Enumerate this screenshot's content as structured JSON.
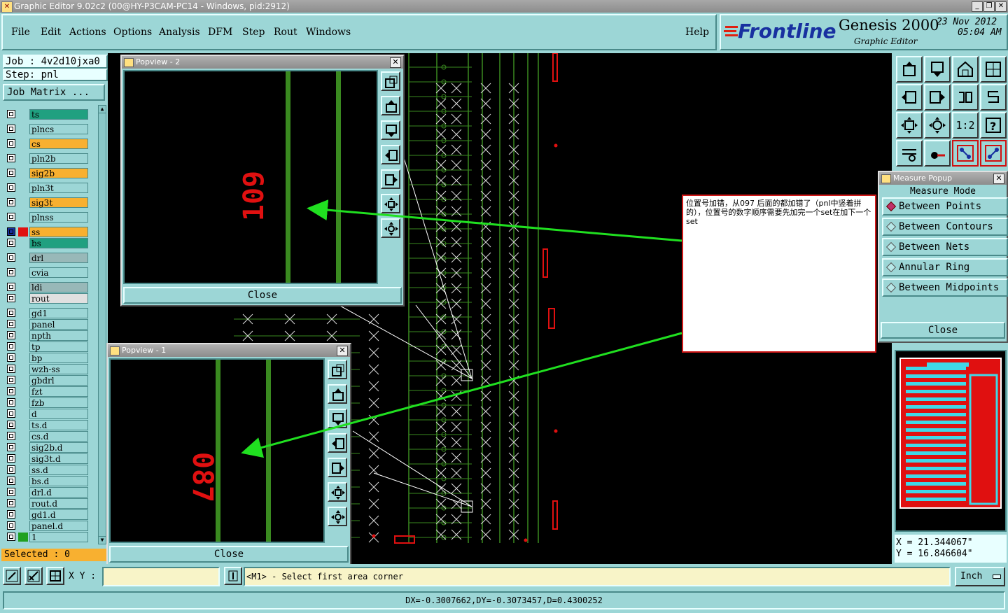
{
  "window": {
    "title": "Graphic Editor 9.02c2 (00@HY-P3CAM-PC14 - Windows, pid:2912)"
  },
  "menu": {
    "items": [
      "File",
      "Edit",
      "Actions",
      "Options",
      "Analysis",
      "DFM",
      "Step",
      "Rout",
      "Windows"
    ],
    "help": "Help"
  },
  "brand": {
    "logo": "Frontline",
    "product": "Genesis 2000",
    "subtitle": "Graphic Editor",
    "date": "23 Nov 2012",
    "time": "05:04 AM"
  },
  "job": {
    "job_label": "Job : 4v2d10jxa0",
    "step_label": "Step: pnl",
    "matrix_button": "Job Matrix ..."
  },
  "layers": [
    {
      "name": "ts",
      "color": "#20a080"
    },
    {
      "name": "plncs",
      "color": "#9cd6d6"
    },
    {
      "name": "cs",
      "color": "#f8b030"
    },
    {
      "name": "pln2b",
      "color": "#9cd6d6"
    },
    {
      "name": "sig2b",
      "color": "#f8b030"
    },
    {
      "name": "pln3t",
      "color": "#9cd6d6"
    },
    {
      "name": "sig3t",
      "color": "#f8b030"
    },
    {
      "name": "plnss",
      "color": "#9cd6d6"
    },
    {
      "name": "ss",
      "color": "#f8b030"
    },
    {
      "name": "bs",
      "color": "#20a080"
    },
    {
      "name": "drl",
      "color": "#98b8b8"
    },
    {
      "name": "cvia",
      "color": "#9cd6d6"
    },
    {
      "name": "ldi",
      "color": "#98b8b8"
    },
    {
      "name": "rout",
      "color": "#e0e0e0"
    },
    {
      "name": "gd1",
      "color": "#9cd6d6"
    },
    {
      "name": "panel",
      "color": "#9cd6d6"
    },
    {
      "name": "npth",
      "color": "#9cd6d6"
    },
    {
      "name": "tp",
      "color": "#9cd6d6"
    },
    {
      "name": "bp",
      "color": "#9cd6d6"
    },
    {
      "name": "wzh-ss",
      "color": "#9cd6d6"
    },
    {
      "name": "gbdrl",
      "color": "#9cd6d6"
    },
    {
      "name": "fzt",
      "color": "#9cd6d6"
    },
    {
      "name": "fzb",
      "color": "#9cd6d6"
    },
    {
      "name": "d",
      "color": "#9cd6d6"
    },
    {
      "name": "ts.d",
      "color": "#9cd6d6"
    },
    {
      "name": "cs.d",
      "color": "#9cd6d6"
    },
    {
      "name": "sig2b.d",
      "color": "#9cd6d6"
    },
    {
      "name": "sig3t.d",
      "color": "#9cd6d6"
    },
    {
      "name": "ss.d",
      "color": "#9cd6d6"
    },
    {
      "name": "bs.d",
      "color": "#9cd6d6"
    },
    {
      "name": "drl.d",
      "color": "#9cd6d6"
    },
    {
      "name": "rout.d",
      "color": "#9cd6d6"
    },
    {
      "name": "gd1.d",
      "color": "#9cd6d6"
    },
    {
      "name": "panel.d",
      "color": "#9cd6d6"
    },
    {
      "name": "1",
      "color": "#9cd6d6"
    }
  ],
  "selected_label": "Selected : 0",
  "popview2": {
    "title": "Popview - 2",
    "label": "109",
    "close": "Close"
  },
  "popview1": {
    "title": "Popview - 1",
    "label": "087",
    "close": "Close"
  },
  "measure": {
    "title": "Measure Popup",
    "header": "Measure Mode",
    "modes": [
      "Between Points",
      "Between Contours",
      "Between Nets",
      "Annular Ring",
      "Between Midpoints"
    ],
    "close": "Close"
  },
  "annotation": {
    "text": "位置号加错，从097 后面的都加错了（pnl中竖着拼的），位置号的数字顺序需要先加完一个set在加下一个set"
  },
  "toolbar_right": {
    "scale_label": "1:2"
  },
  "coords": {
    "x": "X = 21.344067\"",
    "y": "Y = 16.846604\""
  },
  "status": {
    "xy_label": "X Y :",
    "prompt": "<M1> - Select first area corner",
    "units": "Inch"
  },
  "message": "DX=-0.3007662,DY=-0.3073457,D=0.4300252",
  "colors": {
    "panel": "#9cd6d6",
    "canvas": "#000000",
    "trace": "#3a8a20",
    "text_red": "#e01010",
    "arrow": "#20e020"
  }
}
